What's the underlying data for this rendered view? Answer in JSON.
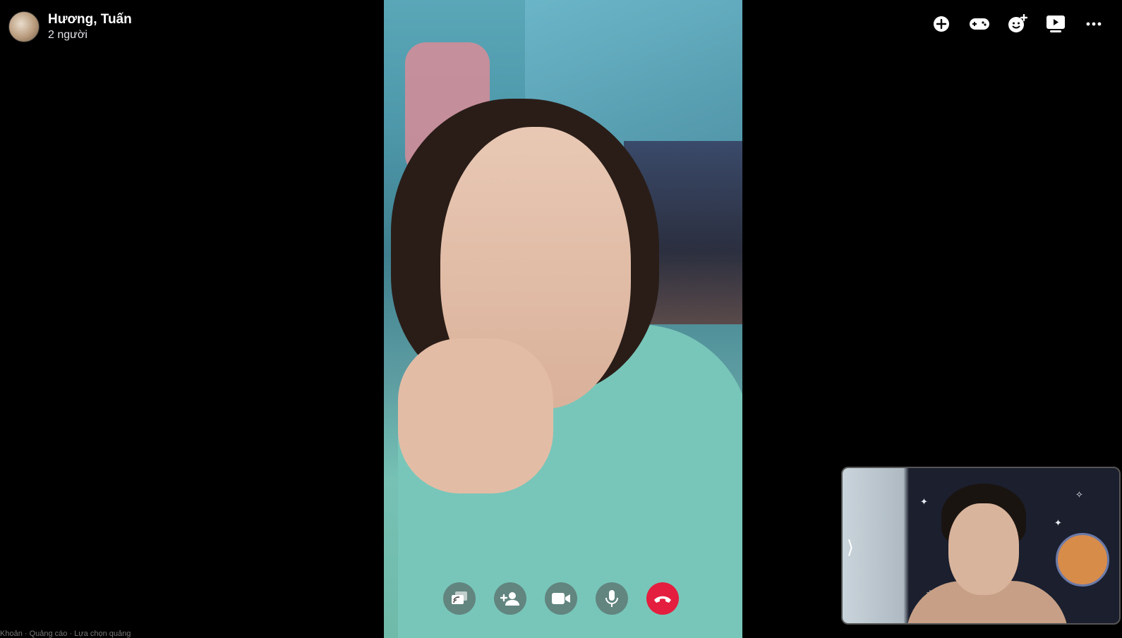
{
  "header": {
    "title": "Hương, Tuấn",
    "subtitle": "2 người"
  },
  "top_actions": [
    {
      "icon": "plus-circle-icon"
    },
    {
      "icon": "gamepad-icon"
    },
    {
      "icon": "add-emoji-icon"
    },
    {
      "icon": "watch-together-icon"
    },
    {
      "icon": "more-icon"
    }
  ],
  "controls": [
    {
      "icon": "share-screen-icon"
    },
    {
      "icon": "add-person-icon"
    },
    {
      "icon": "video-camera-icon"
    },
    {
      "icon": "microphone-icon"
    },
    {
      "icon": "end-call-icon"
    }
  ],
  "self_view": {
    "expand_glyph": "⟩"
  },
  "footer": {
    "partial_text": "Khoản · Quảng cáo · Lựa chọn quảng"
  },
  "colors": {
    "end_call": "#e41e3f",
    "background": "#000000"
  }
}
